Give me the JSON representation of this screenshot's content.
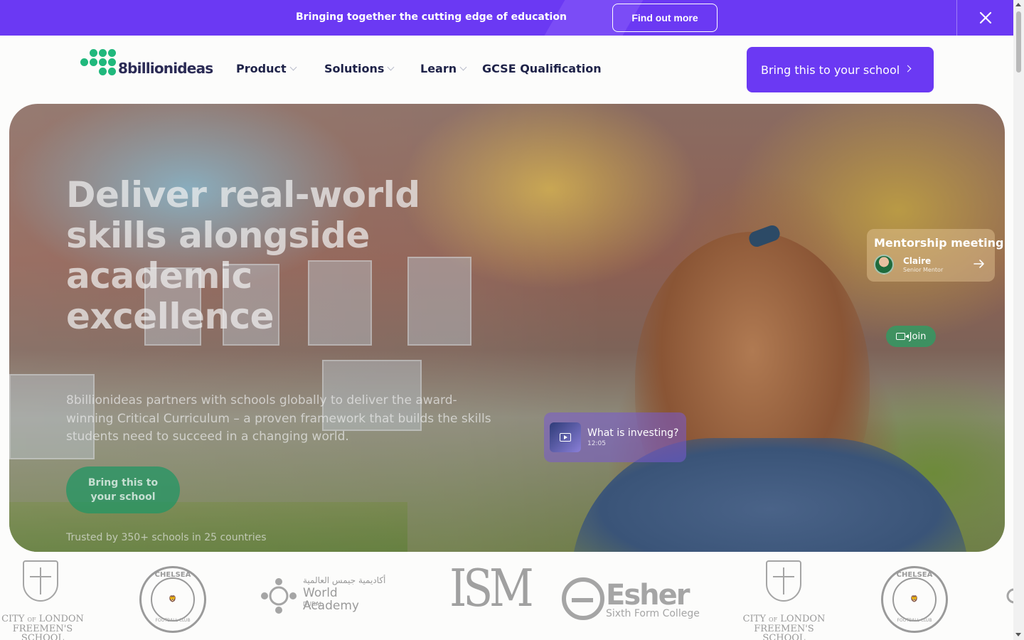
{
  "banner": {
    "text": "Bringing together the cutting edge of education",
    "button": "Find out more",
    "close_icon": "close-icon"
  },
  "nav": {
    "logo_text": "8billionideas",
    "items": [
      {
        "label": "Product",
        "has_dropdown": true
      },
      {
        "label": "Solutions",
        "has_dropdown": true
      },
      {
        "label": "Learn",
        "has_dropdown": true
      },
      {
        "label": "GCSE Qualification",
        "has_dropdown": false
      }
    ],
    "cta": "Bring this to your school"
  },
  "hero": {
    "title": "Deliver real-world skills alongside academic excellence",
    "description": "8billionideas partners with schools globally to deliver the award-winning Critical Curriculum – a proven framework that builds the skills students need to succeed in a changing world.",
    "cta": "Bring this to your school",
    "trust": "Trusted by 350+ schools in 25 countries",
    "mentor_card": {
      "title": "Mentorship meeting",
      "name": "Claire",
      "role": "Senior Mentor"
    },
    "join_button": "Join",
    "video_card": {
      "title": "What is investing?",
      "duration": "12:05"
    }
  },
  "logos": {
    "city_of_london_line1": "CITY",
    "city_of_london_of": "OF",
    "city_of_london_line1b": "LONDON",
    "city_of_london_line2": "FREEMEN'S SCHOOL",
    "chelsea_top": "CHELSEA",
    "chelsea_bottom": "FOOTBALL CLUB",
    "gems_arabic": "أكاديمية جيمس العالمية",
    "gems_name": "World Academy",
    "gems_city": "DUBAI",
    "ism": "ISM",
    "esher_name": "Esher",
    "esher_sub": "Sixth Form College"
  },
  "colors": {
    "brand_purple": "#6b39f3",
    "brand_green": "#20b87c",
    "text_dark": "#1e2248"
  }
}
